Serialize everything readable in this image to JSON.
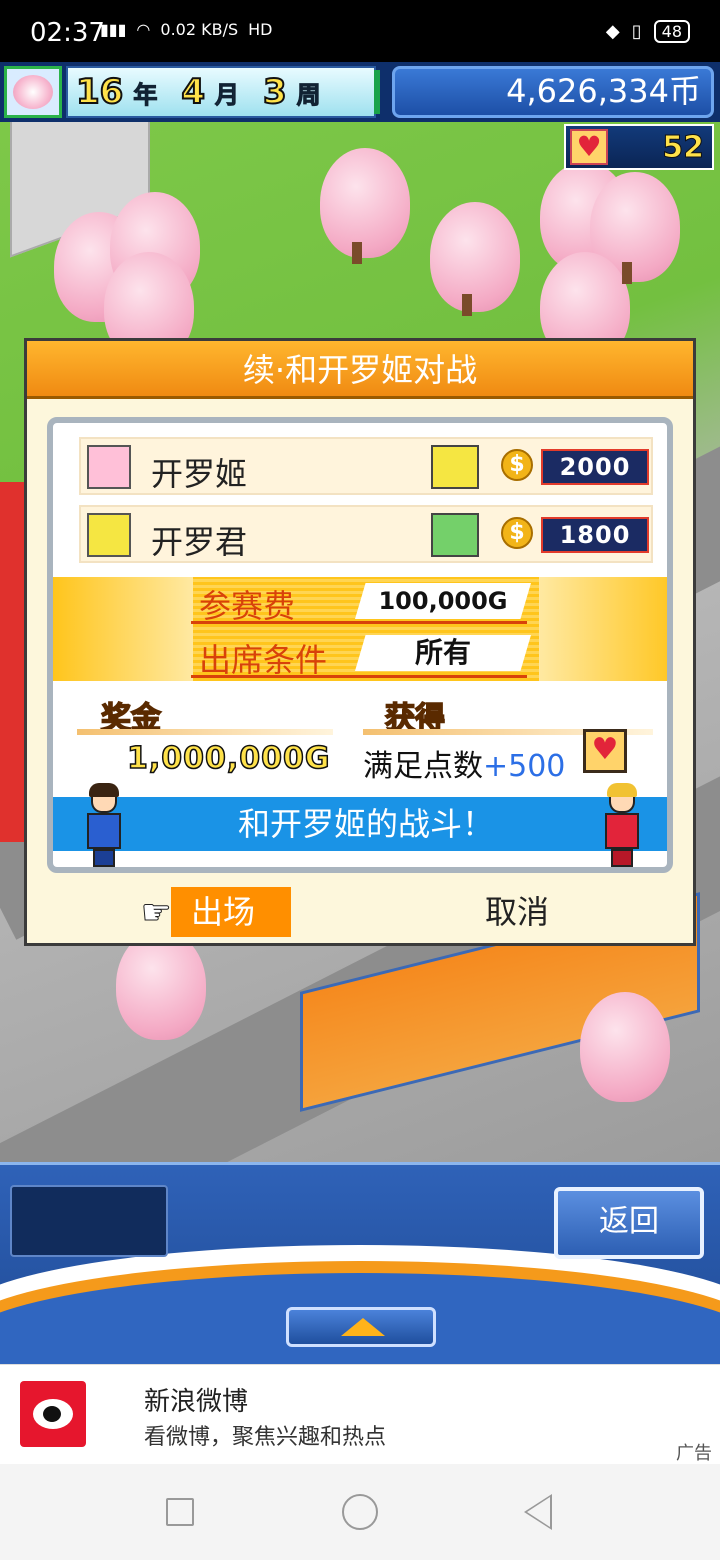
{
  "status": {
    "time": "02:37",
    "net_speed": "0.02 KB/S",
    "hd": "HD",
    "signal": "4G",
    "battery": "48"
  },
  "hud": {
    "year": "16",
    "year_unit": "年",
    "month": "4",
    "month_unit": "月",
    "week": "3",
    "week_unit": "周",
    "money": "4,626,334币",
    "hearts": "52"
  },
  "dialog": {
    "title": "续·和开罗姬对战",
    "opponents": [
      {
        "name": "开罗姬",
        "score": "2000",
        "coin": "$"
      },
      {
        "name": "开罗君",
        "score": "1800",
        "coin": "$"
      }
    ],
    "entry_fee_label": "参赛费",
    "entry_fee_value": "100,000G",
    "condition_label": "出席条件",
    "condition_value": "所有",
    "prize_label": "奖金",
    "prize_value": "1,000,000G",
    "gain_label": "获得",
    "gain_text": "满足点数",
    "gain_bonus": "+500",
    "battle_text": "和开罗姬的战斗！",
    "go_label": "出场",
    "cancel_label": "取消"
  },
  "panel": {
    "back_label": "返回"
  },
  "ad": {
    "title": "新浪微博",
    "subtitle": "看微博，聚焦兴趣和热点",
    "tag": "广告"
  },
  "colors": {
    "dialog_title": "#f08a12",
    "battle_bar": "#1a93e6",
    "go_button": "#ff8f00",
    "panel": "#2f62b8"
  }
}
